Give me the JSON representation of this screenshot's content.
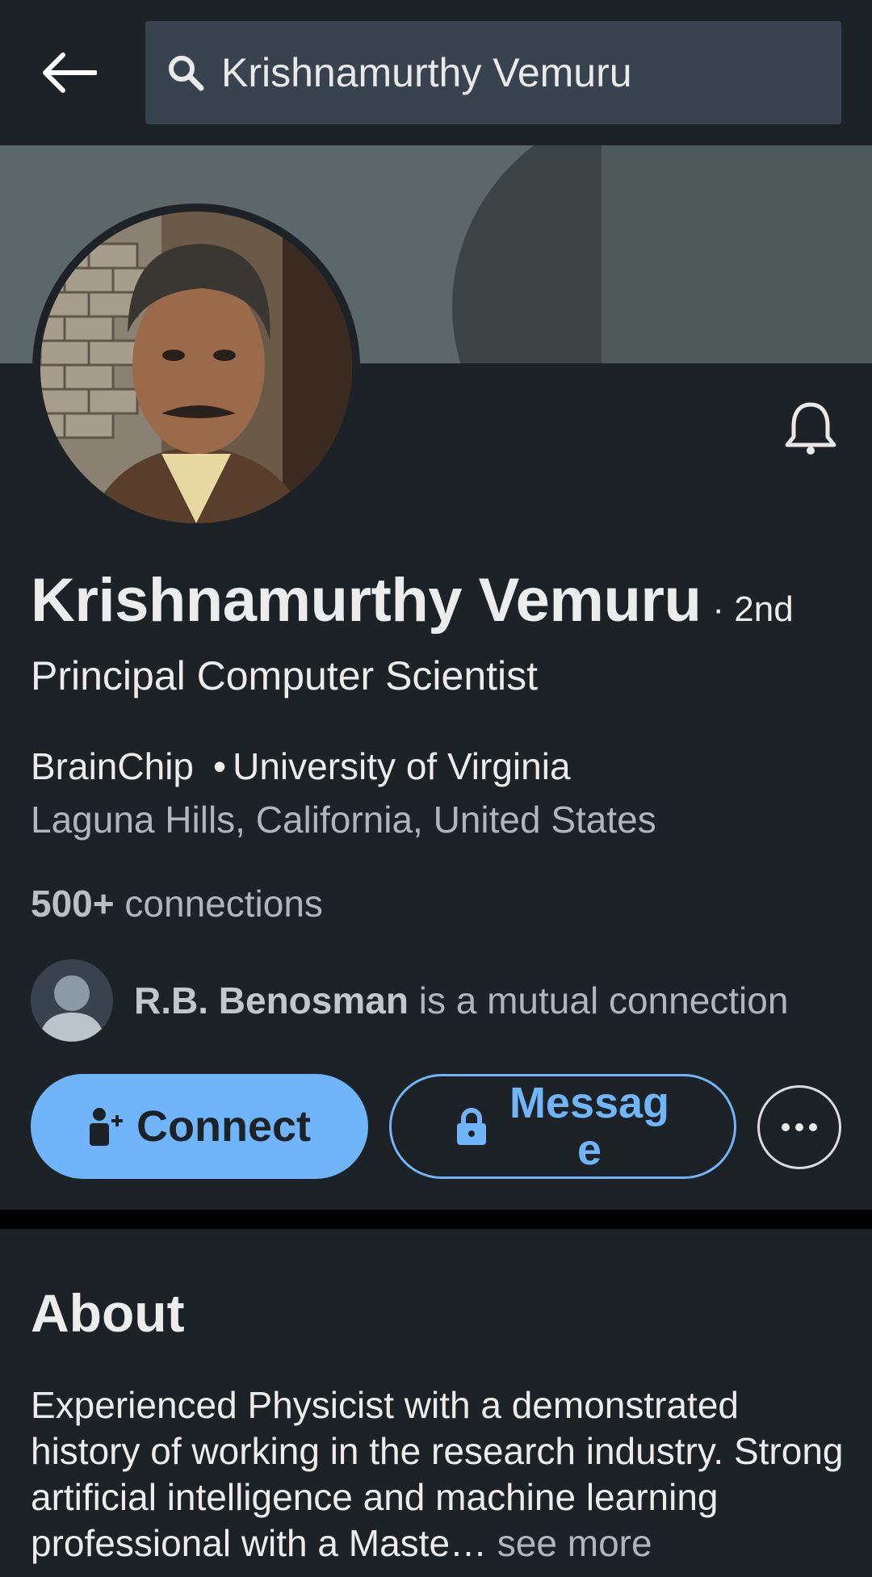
{
  "search": {
    "value": "Krishnamurthy Vemuru"
  },
  "profile": {
    "name": "Krishnamurthy Vemuru",
    "degree": "· 2nd",
    "headline": "Principal Computer Scientist",
    "company": "BrainChip",
    "school": "University of Virginia",
    "separator": "•",
    "location": "Laguna Hills, California, United States",
    "connections_count": "500+",
    "connections_label": " connections"
  },
  "mutual": {
    "name": "R.B. Benosman",
    "text": " is a mutual connection"
  },
  "actions": {
    "connect_label": "Connect",
    "message_label": "Message"
  },
  "about": {
    "title": "About",
    "text": "Experienced Physicist with a demonstrated history of working in the research industry. Strong artificial intelligence and machine learning professional with a Maste…",
    "see_more": " see more"
  },
  "icons": {
    "back": "arrow-left-icon",
    "search": "search-icon",
    "bell": "bell-icon",
    "connect": "add-person-icon",
    "message": "lock-icon",
    "more": "ellipsis-icon"
  },
  "colors": {
    "background": "#1d2226",
    "accent": "#70b5f9",
    "search_bg": "#38434f"
  }
}
